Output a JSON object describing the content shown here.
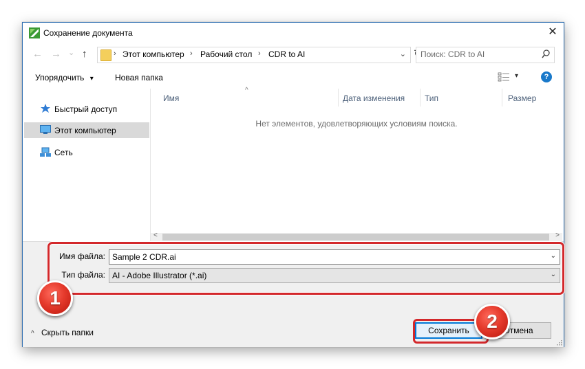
{
  "dialog": {
    "title": "Сохранение документа",
    "close_glyph": "✕"
  },
  "nav": {
    "back_glyph": "←",
    "forward_glyph": "→",
    "recent_glyph": "⌄",
    "up_glyph": "↑",
    "breadcrumbs": [
      "Этот компьютер",
      "Рабочий стол",
      "CDR to AI"
    ],
    "crumb_sep": "›",
    "dropdown_glyph": "⌄",
    "refresh_glyph": "↻",
    "search_placeholder": "Поиск: CDR to AI"
  },
  "toolbar": {
    "organize_label": "Упорядочить",
    "organize_caret": "▾",
    "new_folder_label": "Новая папка",
    "view_caret": "▾",
    "help_label": "?"
  },
  "sidebar": {
    "items": [
      {
        "label": "Быстрый доступ",
        "icon": "star-icon"
      },
      {
        "label": "Этот компьютер",
        "icon": "computer-icon",
        "selected": true
      },
      {
        "label": "Сеть",
        "icon": "network-icon"
      }
    ]
  },
  "file_list": {
    "sort_glyph": "^",
    "columns": [
      "Имя",
      "Дата изменения",
      "Тип",
      "Размер"
    ],
    "empty_message": "Нет элементов, удовлетворяющих условиям поиска.",
    "scroll_left_glyph": "<",
    "scroll_right_glyph": ">"
  },
  "form": {
    "filename_label": "Имя файла:",
    "filename_value": "Sample 2 CDR.ai",
    "filetype_label": "Тип файла:",
    "filetype_value": "AI - Adobe Illustrator (*.ai)",
    "dropdown_glyph": "⌄"
  },
  "footer": {
    "hide_folders_chevron": "^",
    "hide_folders_label": "Скрыть папки",
    "save_label": "Сохранить",
    "cancel_label": "Отмена"
  },
  "annotations": {
    "badge1": "1",
    "badge2": "2",
    "highlight_color": "#d3282b"
  },
  "colors": {
    "accent": "#0078d7",
    "help": "#1979ca",
    "selected_nav": "#d9d9d9"
  }
}
